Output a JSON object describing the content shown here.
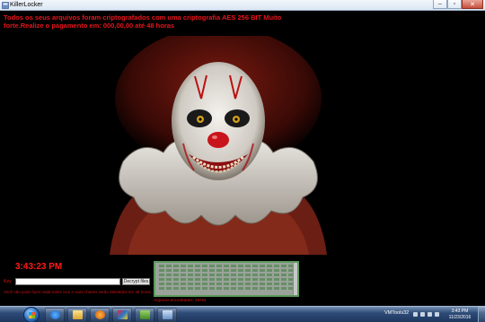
{
  "window": {
    "title": "KillerLocker"
  },
  "message": "Todos os seus arquivos foram criptografados com uma criptografia AES 256 BIT Muito forte.Realize o pagamento em: 000,00,00  até 48 horas",
  "timer": "3:43:23 PM",
  "key_label": "Key",
  "key_value": "",
  "decrypt_button": "Decrypt files",
  "warning": "Você não pode fazer nada sobre isso e suas chaves serão deletados em 48 horas",
  "counter": "Arquivos encontrados: 25764",
  "taskbar": {
    "vmtools": "VMTools32",
    "time": "3:43 PM",
    "date": "11/23/2016"
  },
  "colors": {
    "alert_red": "#e8141b",
    "background": "#000000",
    "log_green": "#5c9a5c"
  }
}
